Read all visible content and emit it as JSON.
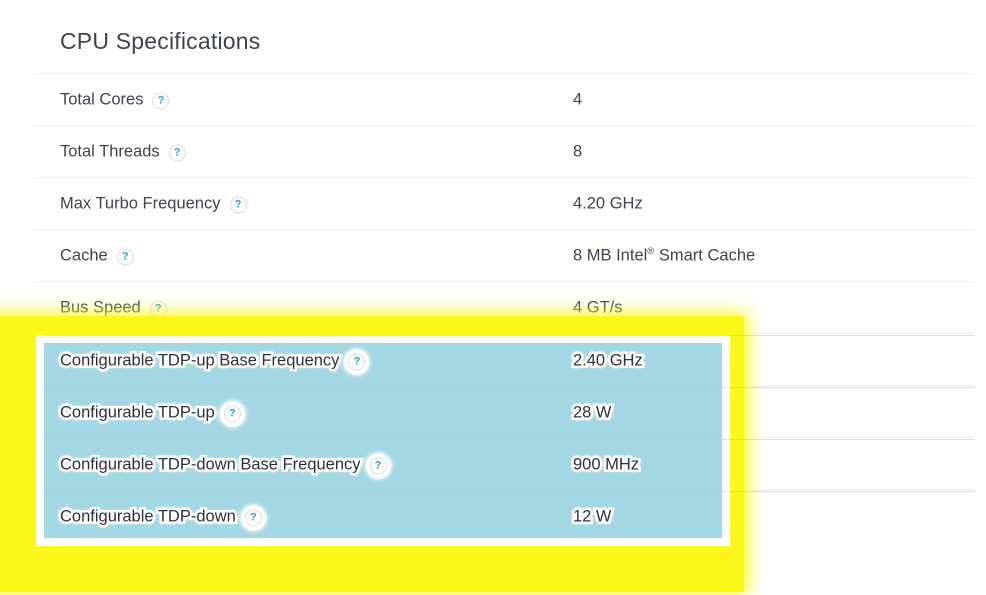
{
  "page": {
    "title": "CPU Specifications",
    "help_icon_glyph": "?",
    "help_icon_name": "question-mark-help-icon"
  },
  "colors": {
    "text": "#3d4450",
    "divider": "#ededf0",
    "help_icon_accent": "#2d9fc0",
    "marker_highlight": "#fbf71a",
    "text_selection": "#a3d7e3",
    "selection_frame": "#ffffff"
  },
  "rows": [
    {
      "label": "Total Cores",
      "value": "4",
      "highlighted": false
    },
    {
      "label": "Total Threads",
      "value": "8",
      "highlighted": false
    },
    {
      "label": "Max Turbo Frequency",
      "value": "4.20 GHz",
      "highlighted": false
    },
    {
      "label": "Cache",
      "value": "8 MB Intel® Smart Cache",
      "highlighted": false
    },
    {
      "label": "Bus Speed",
      "value": "4 GT/s",
      "highlighted": false
    },
    {
      "label": "Configurable TDP-up Base Frequency",
      "value": "2.40 GHz",
      "highlighted": true
    },
    {
      "label": "Configurable TDP-up",
      "value": "28 W",
      "highlighted": true
    },
    {
      "label": "Configurable TDP-down Base Frequency",
      "value": "900 MHz",
      "highlighted": true
    },
    {
      "label": "Configurable TDP-down",
      "value": "12 W",
      "highlighted": true
    }
  ],
  "highlight": {
    "label": "Configurable TDP specification block highlighted with yellow marker and blue text selection"
  }
}
